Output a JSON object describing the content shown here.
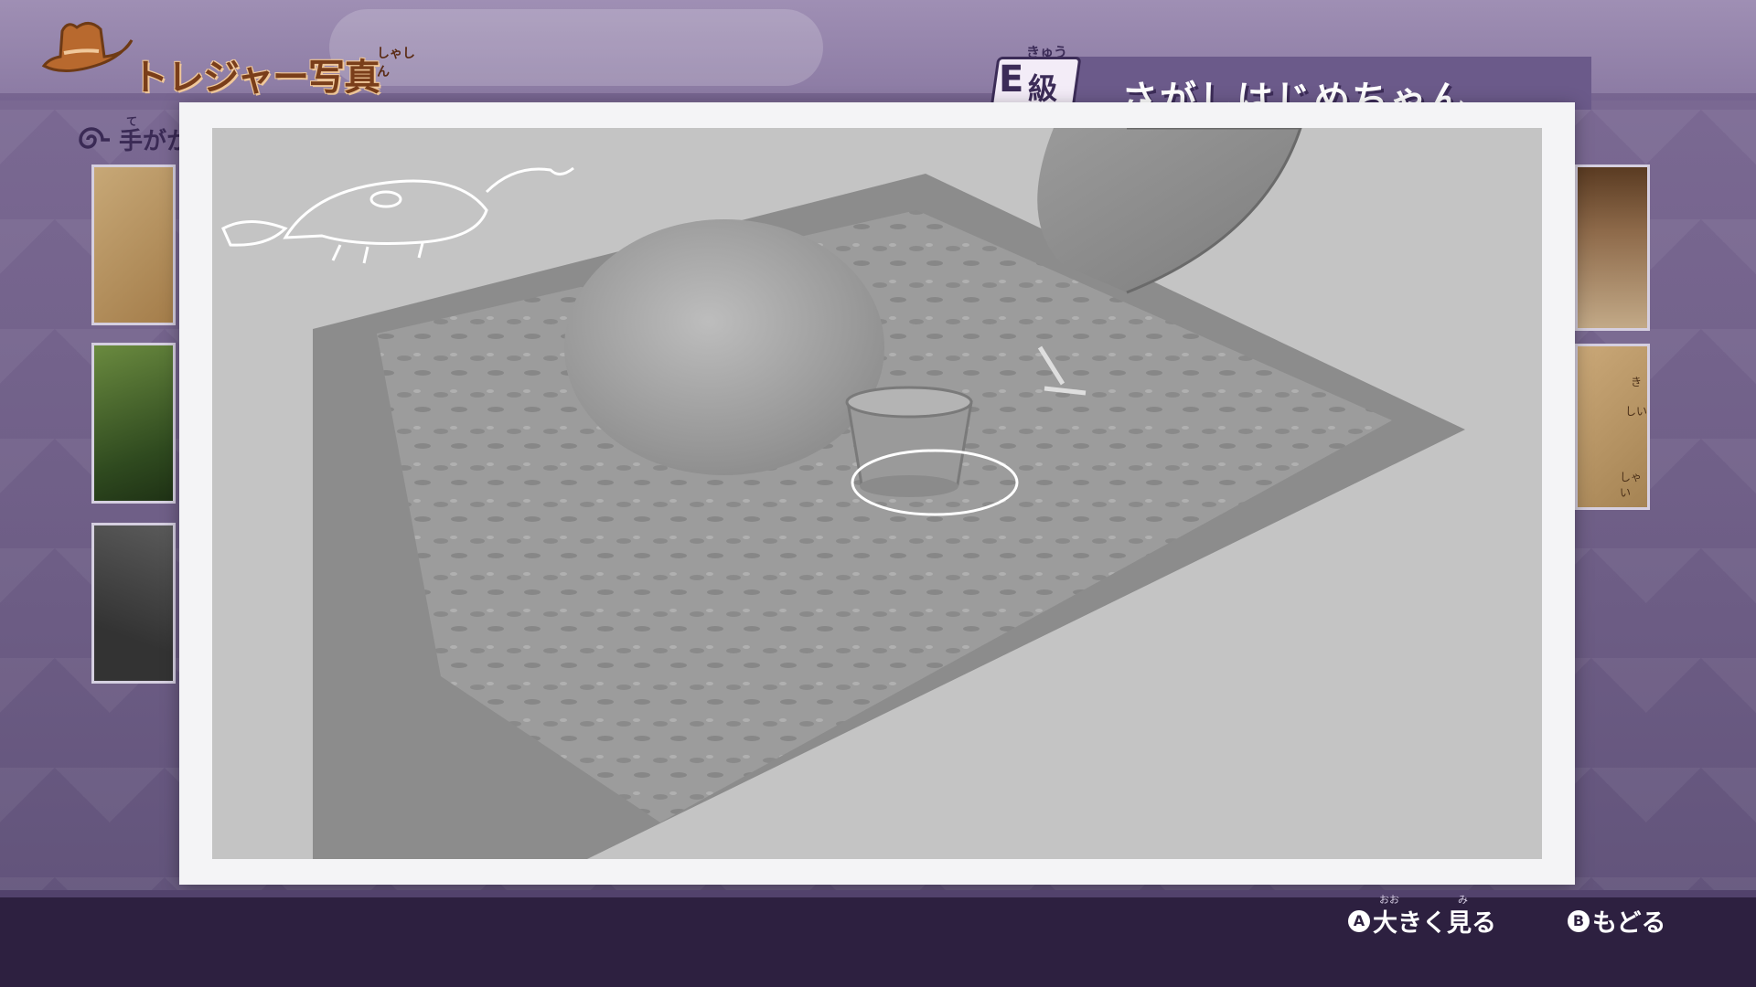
{
  "header": {
    "logo_text": "トレジャー写真",
    "logo_ruby": "しゃしん",
    "level_grade": "E",
    "level_kanji": "級",
    "level_ruby": "きゅう",
    "level_name": "さがしはじめちゃん"
  },
  "sidebar": {
    "clue_label": "手がかり",
    "clue_ruby": "て",
    "right_thumb_text": [
      "き",
      "しい",
      "しゃい"
    ]
  },
  "photo": {
    "subject": "sandbox-with-bucket",
    "highlight_color": "#ffffff"
  },
  "footer": {
    "hint_a_button": "A",
    "hint_a_label": "大きく見る",
    "hint_a_ruby_1": "おお",
    "hint_a_ruby_2": "み",
    "hint_b_button": "B",
    "hint_b_label": "もどる"
  },
  "colors": {
    "header": "#8b7aa3",
    "background": "#6e5f86",
    "footer": "#2d2040",
    "logo": "#7a3e1a",
    "frame": "#f4f4f6"
  }
}
